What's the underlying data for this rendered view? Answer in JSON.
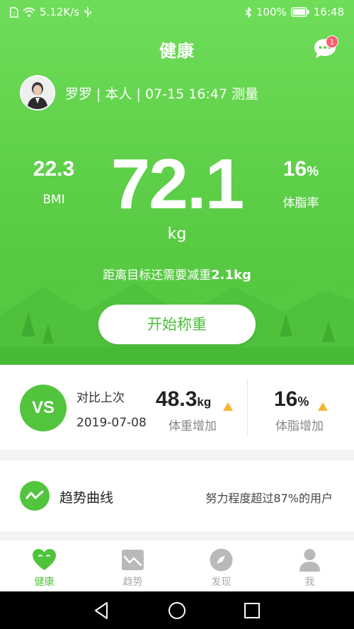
{
  "status_bar": {
    "net_speed": "5.12K/s",
    "battery": "100%",
    "time": "16:48"
  },
  "header": {
    "title": "健康",
    "message_badge": "1"
  },
  "user": {
    "info": "罗罗 | 本人 | 07-15 16:47 测量"
  },
  "metrics": {
    "weight": "72.1",
    "weight_unit": "kg",
    "bmi": "22.3",
    "bmi_label": "BMI",
    "body_fat": "16",
    "body_fat_unit": "%",
    "body_fat_label": "体脂率"
  },
  "goal": {
    "prefix": "距离目标还需要减重",
    "amount": "2.1kg"
  },
  "start_button": "开始称重",
  "compare": {
    "vs": "VS",
    "title": "对比上次",
    "date": "2019-07-08",
    "weight_change": "48.3",
    "weight_change_unit": "kg",
    "weight_change_label": "体重增加",
    "fat_change": "16",
    "fat_change_unit": "%",
    "fat_change_label": "体脂增加",
    "trend_color": "#f5b534"
  },
  "trend": {
    "title": "趋势曲线",
    "description": "努力程度超过87%的用户"
  },
  "tabs": [
    {
      "label": "健康",
      "icon": "heart-face-icon",
      "active": true
    },
    {
      "label": "趋势",
      "icon": "chart-icon",
      "active": false
    },
    {
      "label": "发现",
      "icon": "compass-icon",
      "active": false
    },
    {
      "label": "我",
      "icon": "person-icon",
      "active": false
    }
  ],
  "colors": {
    "primary_green": "#52c43e",
    "tab_inactive": "#aaaaaa",
    "badge": "#ff5b6c"
  }
}
